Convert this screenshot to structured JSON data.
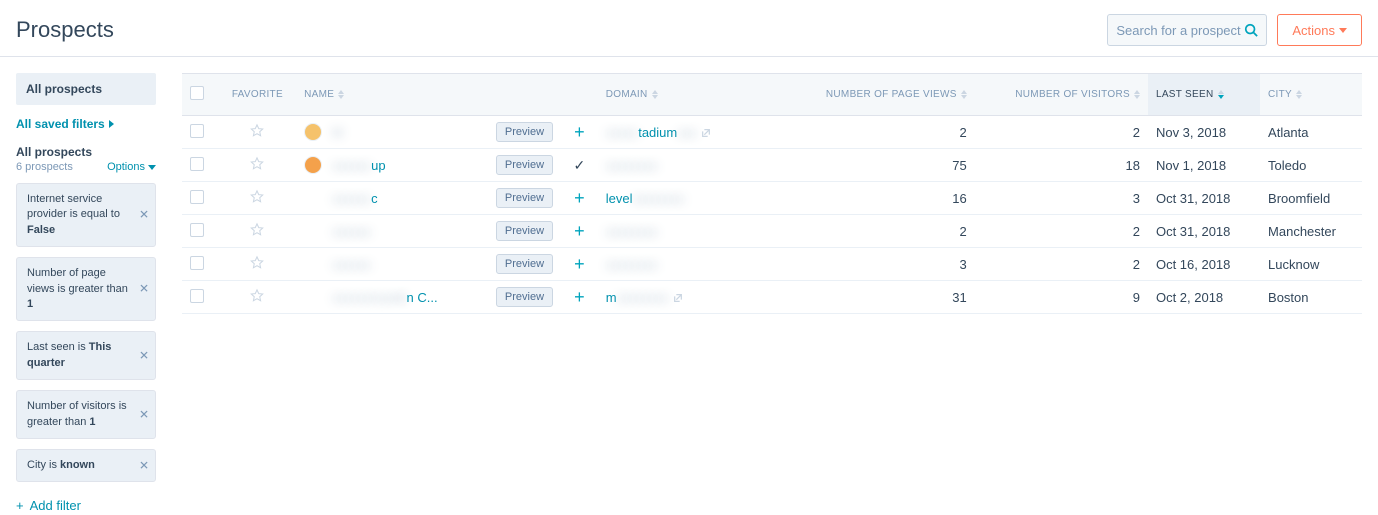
{
  "header": {
    "title": "Prospects",
    "search_placeholder": "Search for a prospect",
    "actions_label": "Actions"
  },
  "sidebar": {
    "active_tab": "All prospects",
    "saved_filters_label": "All saved filters",
    "list_title": "All prospects",
    "count_label": "6 prospects",
    "options_label": "Options",
    "filters": [
      {
        "pre": "Internet service provider is equal to ",
        "bold": "False"
      },
      {
        "pre": "Number of page views is greater than ",
        "bold": "1"
      },
      {
        "pre": "Last seen is ",
        "bold": "This quarter"
      },
      {
        "pre": "Number of visitors is greater than ",
        "bold": "1"
      },
      {
        "pre": "City is ",
        "bold": "known"
      }
    ],
    "add_filter_label": "Add filter"
  },
  "table": {
    "columns": {
      "favorite": "FAVORITE",
      "name": "NAME",
      "domain": "DOMAIN",
      "page_views": "NUMBER OF PAGE VIEWS",
      "visitors": "NUMBER OF VISITORS",
      "last_seen": "LAST SEEN",
      "city": "CITY"
    },
    "preview_label": "Preview",
    "rows": [
      {
        "name_masked": "M",
        "domain_prefix": "",
        "domain_mid": "tadium",
        "domain_suffix": "",
        "added": false,
        "page_views": "2",
        "visitors": "2",
        "last_seen": "Nov 3, 2018",
        "city": "Atlanta",
        "avatar_color": "#f5c26b"
      },
      {
        "name_masked": "",
        "name_suffix": "up",
        "domain_prefix": "",
        "domain_mid": "",
        "domain_suffix": "",
        "added": true,
        "page_views": "75",
        "visitors": "18",
        "last_seen": "Nov 1, 2018",
        "city": "Toledo",
        "avatar_color": "#f4a14b"
      },
      {
        "name_masked": "",
        "name_suffix": "c",
        "domain_prefix": "level",
        "domain_mid": "",
        "domain_suffix": "",
        "added": false,
        "page_views": "16",
        "visitors": "3",
        "last_seen": "Oct 31, 2018",
        "city": "Broomfield",
        "avatar_color": "transparent"
      },
      {
        "name_masked": "",
        "domain_prefix": "",
        "domain_mid": "",
        "domain_suffix": "",
        "added": false,
        "page_views": "2",
        "visitors": "2",
        "last_seen": "Oct 31, 2018",
        "city": "Manchester",
        "avatar_color": "transparent"
      },
      {
        "name_masked": "",
        "domain_prefix": "",
        "domain_mid": "",
        "domain_suffix": "",
        "added": false,
        "page_views": "3",
        "visitors": "2",
        "last_seen": "Oct 16, 2018",
        "city": "Lucknow",
        "avatar_color": "transparent"
      },
      {
        "name_masked": "",
        "name_mid": "nusett",
        "name_suffix": "n C...",
        "domain_prefix": "m",
        "domain_mid": "",
        "domain_suffix": "",
        "added": false,
        "page_views": "31",
        "visitors": "9",
        "last_seen": "Oct 2, 2018",
        "city": "Boston",
        "avatar_color": "transparent"
      }
    ]
  }
}
